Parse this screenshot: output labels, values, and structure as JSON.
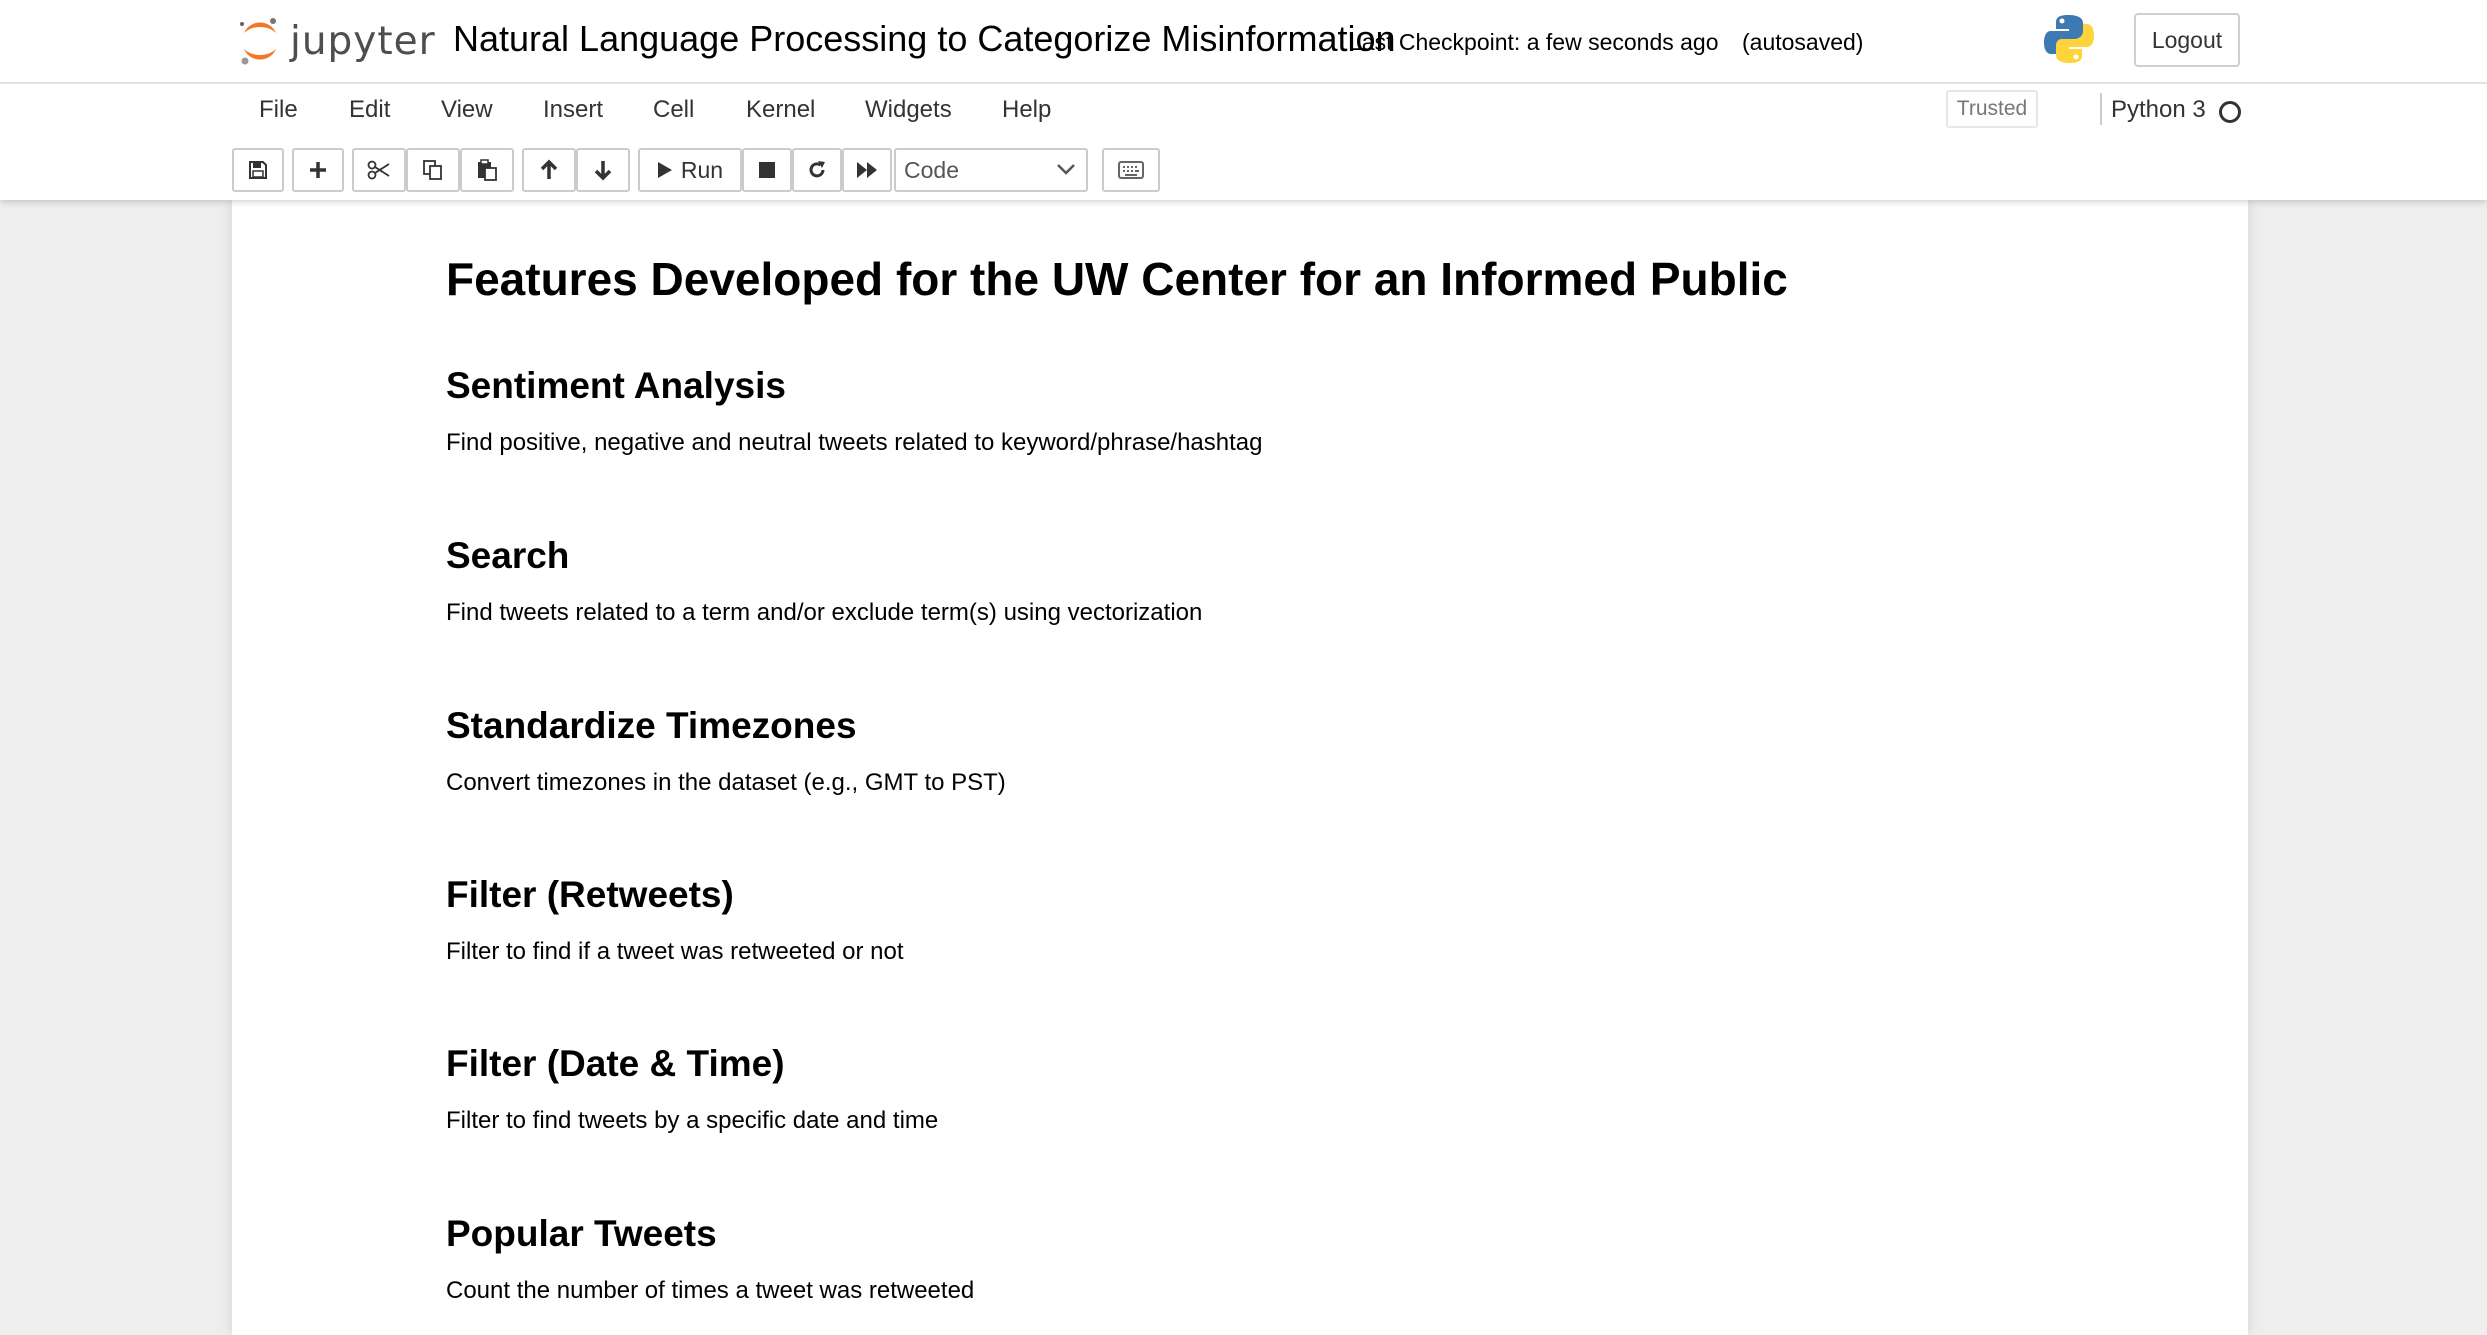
{
  "header": {
    "logo_text": "jupyter",
    "notebook_title": "Natural Language Processing to Categorize Misinformation",
    "checkpoint": "Last Checkpoint: a few seconds ago",
    "autosave": "(autosaved)",
    "logout_label": "Logout"
  },
  "menubar": {
    "items": [
      "File",
      "Edit",
      "View",
      "Insert",
      "Cell",
      "Kernel",
      "Widgets",
      "Help"
    ],
    "trusted_label": "Trusted",
    "kernel_name": "Python 3"
  },
  "toolbar": {
    "run_label": "Run",
    "cell_type": "Code",
    "icons": [
      "save-icon",
      "plus-icon",
      "cut-icon",
      "copy-icon",
      "paste-icon",
      "arrow-up-icon",
      "arrow-down-icon",
      "play-icon",
      "stop-icon",
      "restart-icon",
      "fast-forward-icon",
      "keyboard-icon"
    ]
  },
  "notebook": {
    "title": "Features Developed for the UW Center for an Informed Public",
    "sections": [
      {
        "heading": "Sentiment Analysis",
        "text": "Find positive, negative and neutral tweets related to keyword/phrase/hashtag"
      },
      {
        "heading": "Search",
        "text": "Find tweets related to a term and/or exclude term(s) using vectorization"
      },
      {
        "heading": "Standardize Timezones",
        "text": "Convert timezones in the dataset (e.g., GMT to PST)"
      },
      {
        "heading": "Filter (Retweets)",
        "text": "Filter to find if a tweet was retweeted or not"
      },
      {
        "heading": "Filter (Date & Time)",
        "text": "Filter to find tweets by a specific date and time"
      },
      {
        "heading": "Popular Tweets",
        "text": "Count the number of times a tweet was retweeted"
      }
    ]
  },
  "colors": {
    "jupyter_orange": "#f37726",
    "background": "#eeeeee",
    "python_blue": "#3d7ab3",
    "python_yellow": "#ffd43b"
  }
}
